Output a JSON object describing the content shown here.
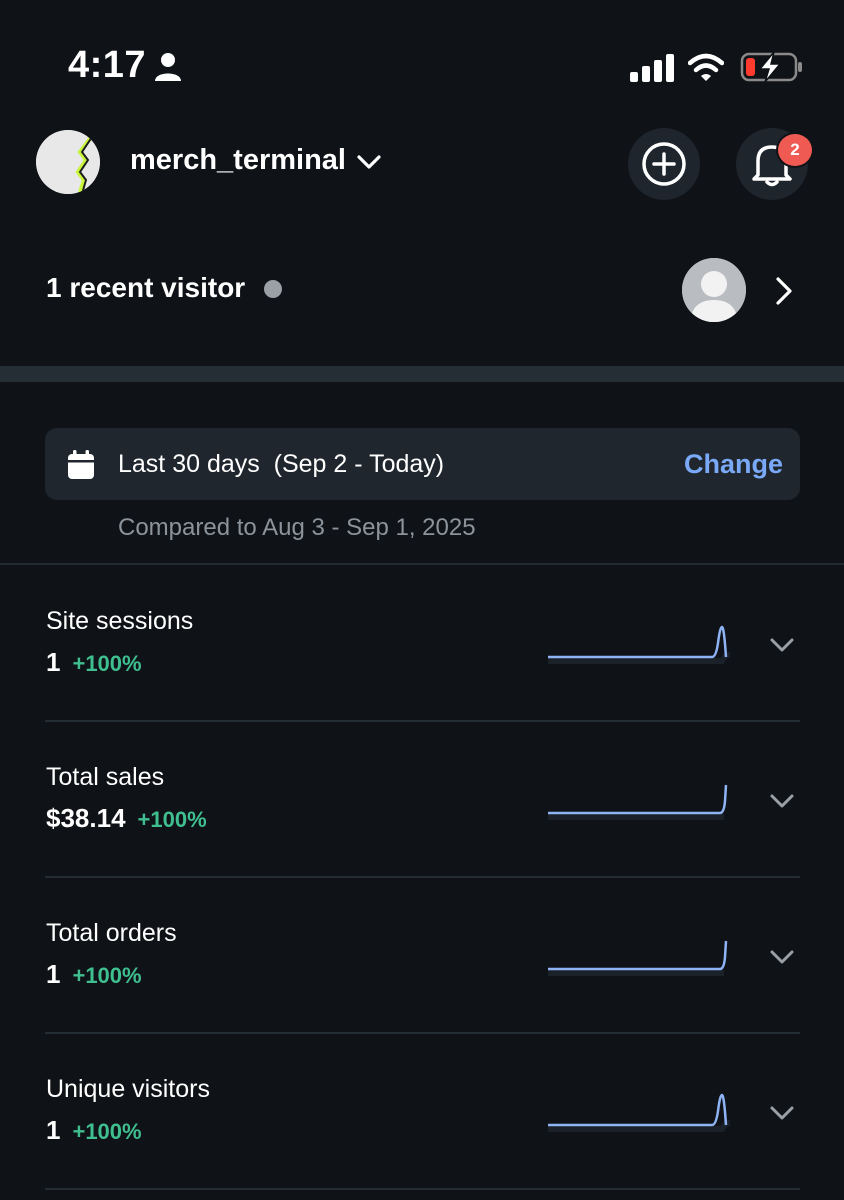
{
  "status_bar": {
    "time": "4:17",
    "icons": [
      "person-icon",
      "signal-icon",
      "wifi-icon",
      "battery-charging-icon"
    ]
  },
  "header": {
    "site_name": "merch_terminal",
    "notification_count": "2",
    "icons": [
      "add-icon",
      "bell-icon",
      "chevron-down-icon"
    ]
  },
  "visitors": {
    "label": "1 recent visitor"
  },
  "date_range": {
    "label": "Last 30 days  (Sep 2 - Today)",
    "change_label": "Change",
    "comparison": "Compared to Aug 3 - Sep 1, 2025"
  },
  "metrics": [
    {
      "label": "Site sessions",
      "value": "1",
      "change": "+100%"
    },
    {
      "label": "Total sales",
      "value": "$38.14",
      "change": "+100%"
    },
    {
      "label": "Total orders",
      "value": "1",
      "change": "+100%"
    },
    {
      "label": "Unique visitors",
      "value": "1",
      "change": "+100%"
    }
  ],
  "colors": {
    "background": "#0f1216",
    "card": "#1f262d",
    "accent_link": "#7aa9f7",
    "positive_change": "#3fbf90",
    "sparkline": "#8fb4f5",
    "badge": "#ef5b53"
  }
}
